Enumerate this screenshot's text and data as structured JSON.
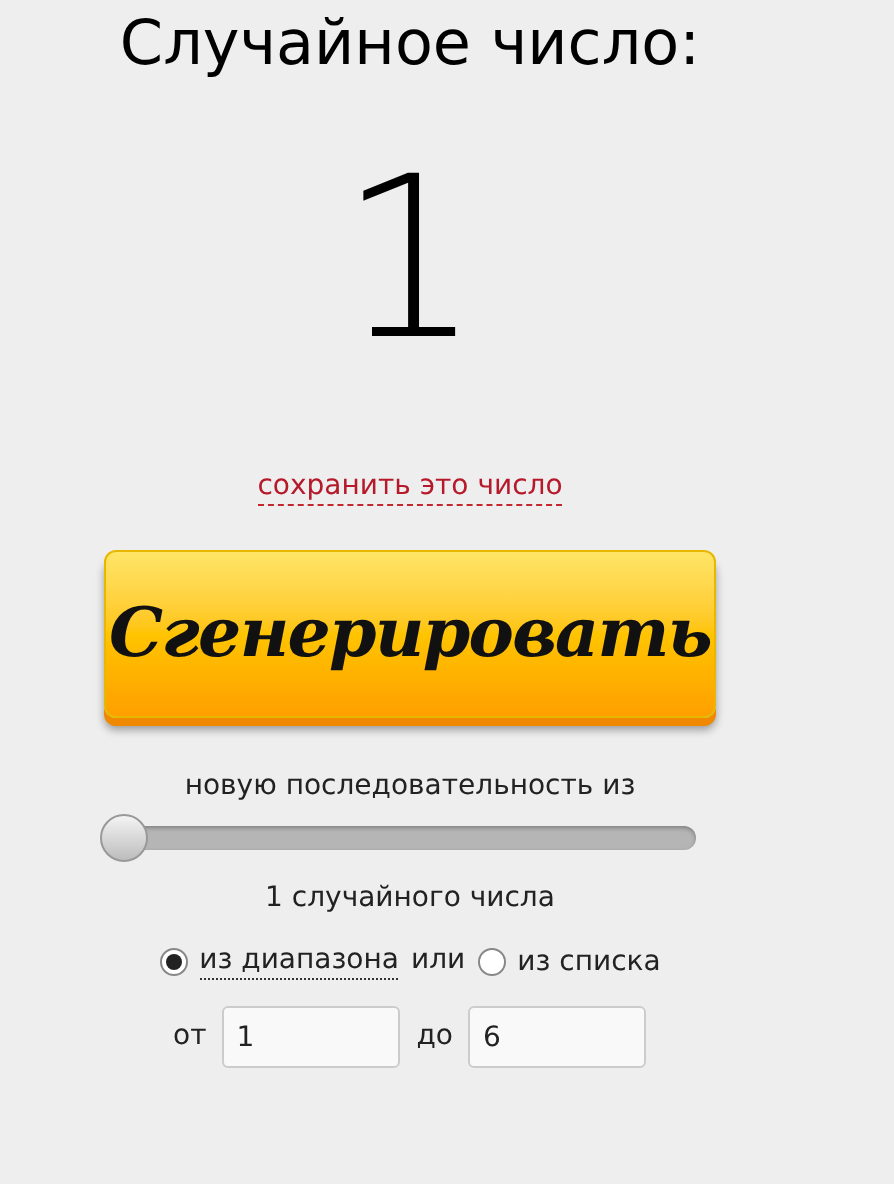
{
  "title": "Случайное число:",
  "result": "1",
  "save_link": "сохранить это число",
  "generate_button": "Сгенерировать",
  "sequence_label": "новую последовательность из",
  "count_slider": {
    "level": 0
  },
  "count_label": "1 случайного числа",
  "source_options": [
    {
      "label": "из диапазона",
      "selected": true,
      "underlined": true
    },
    {
      "label": "из списка",
      "selected": false,
      "underlined": false
    }
  ],
  "or_label": "или",
  "range": {
    "from_label": "от",
    "from_value": "1",
    "to_label": "до",
    "to_value": "6"
  }
}
